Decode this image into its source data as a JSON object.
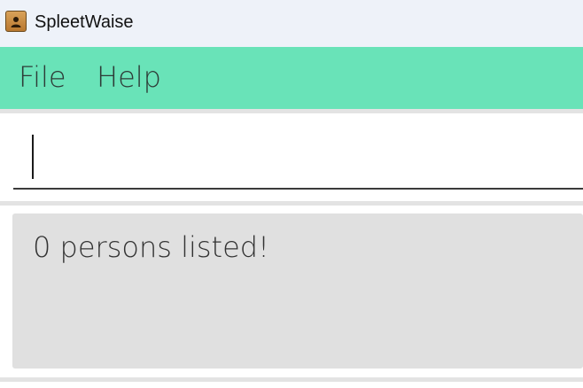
{
  "window": {
    "title": "SpleetWaise",
    "icon": "address-book-icon"
  },
  "menu": {
    "items": [
      {
        "label": "File"
      },
      {
        "label": "Help"
      }
    ]
  },
  "command": {
    "value": ""
  },
  "result": {
    "message": "0 persons listed!"
  },
  "colors": {
    "titlebar": "#eef2f9",
    "menubar": "#69e3b8",
    "result_background": "#e0e0e0",
    "separator": "#e3e3e3"
  }
}
